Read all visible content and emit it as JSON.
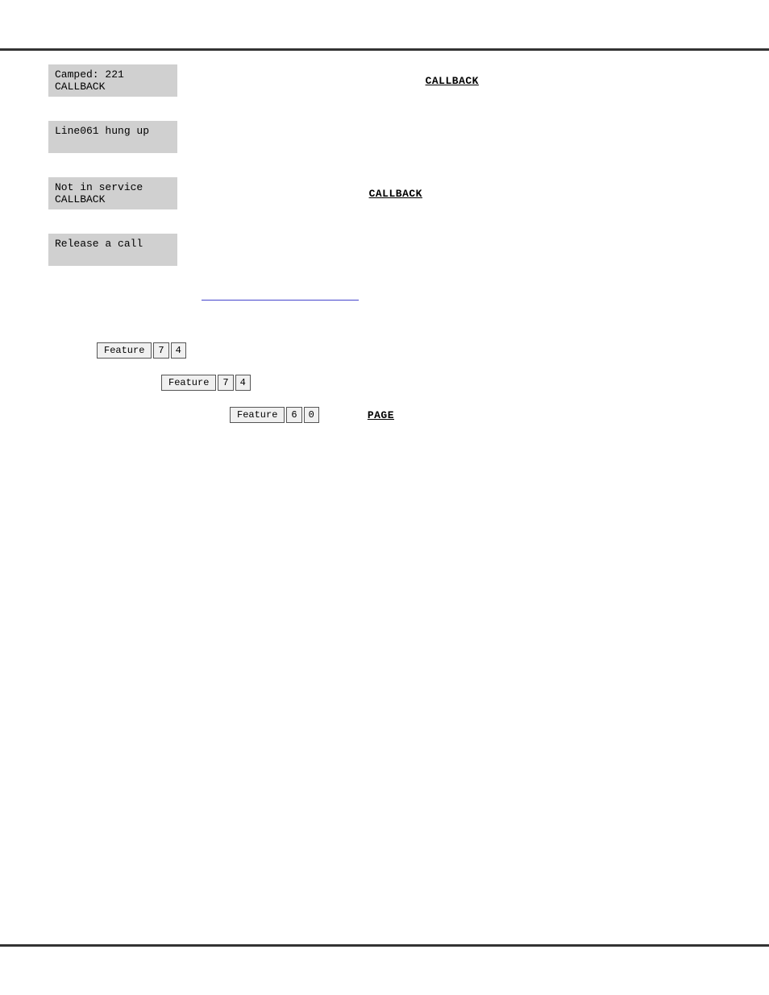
{
  "page": {
    "top_border": true,
    "bottom_border": true
  },
  "sections": [
    {
      "id": "camped",
      "status_line1": "Camped: 221",
      "status_line2": "CALLBACK",
      "link_text": "CALLBACK",
      "link_type": "right"
    },
    {
      "id": "line061",
      "status_line1": "Line061 hung up",
      "status_line2": "",
      "link_text": null,
      "link_type": null
    },
    {
      "id": "not_in_service",
      "status_line1": "Not in service",
      "status_line2": "CALLBACK",
      "link_text": "CALLBACK",
      "link_type": "right"
    },
    {
      "id": "release_call",
      "status_line1": "Release a call",
      "status_line2": "",
      "link_text": null,
      "link_type": null
    }
  ],
  "blue_link": {
    "text": "____________________"
  },
  "feature_rows": [
    {
      "id": "feature1",
      "indent": 0,
      "feature_label": "Feature",
      "key1": "7",
      "key2": "4",
      "right_text": null
    },
    {
      "id": "feature2",
      "indent": 80,
      "feature_label": "Feature",
      "key1": "7",
      "key2": "4",
      "right_text": null
    },
    {
      "id": "feature3",
      "indent": 160,
      "feature_label": "Feature",
      "key1": "6",
      "key2": "0",
      "right_text": "PAGE"
    }
  ]
}
